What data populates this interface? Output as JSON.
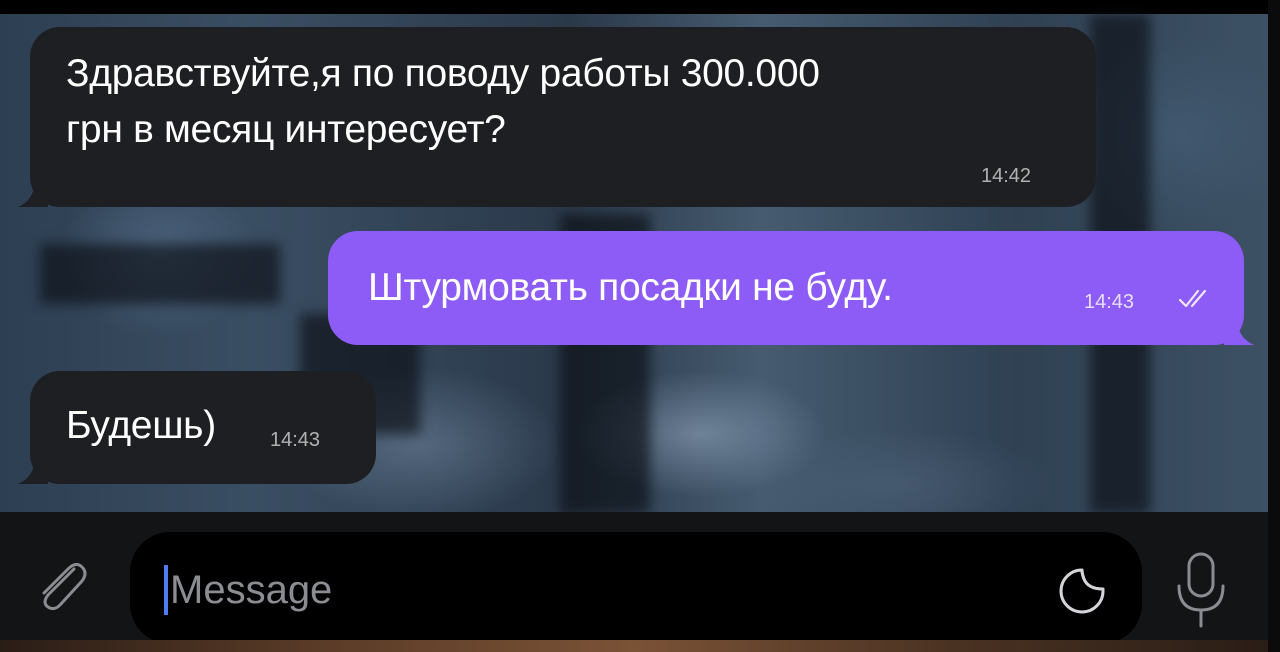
{
  "chat": {
    "messages": [
      {
        "direction": "incoming",
        "lines": [
          "Здравствуйте,я по поводу работы 300.000",
          "грн в месяц интересует?"
        ],
        "time": "14:42"
      },
      {
        "direction": "outgoing",
        "lines": [
          "Штурмовать посадки не буду."
        ],
        "time": "14:43",
        "status_icon": "double-check-icon"
      },
      {
        "direction": "incoming",
        "lines": [
          "Будешь)"
        ],
        "time": "14:43"
      }
    ]
  },
  "composer": {
    "placeholder": "Message",
    "value": "",
    "icons": [
      "paperclip-icon",
      "sticker-icon",
      "microphone-icon"
    ]
  },
  "colors": {
    "incoming_bubble": "#1e1f22",
    "outgoing_bubble": "#8d5cf6",
    "composer_bar": "#131416",
    "caret": "#4f7bf3"
  }
}
